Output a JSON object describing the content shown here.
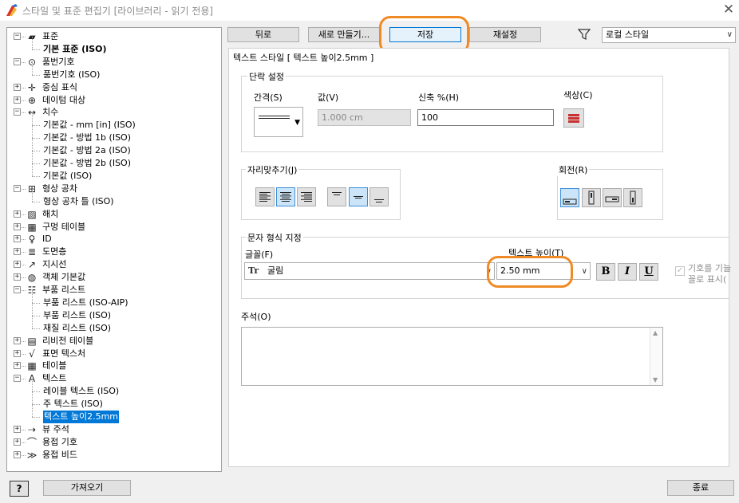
{
  "window": {
    "title": "스타일 및 표준 편집기 [라이브러리 - 읽기 전용]",
    "close_glyph": "✕"
  },
  "tree": [
    {
      "label": "표준",
      "level": 0,
      "toggle": "−",
      "icon": "standard-icon",
      "bold": false
    },
    {
      "label": "기본 표준 (ISO)",
      "level": 1,
      "bold": true
    },
    {
      "label": "품번기호",
      "level": 0,
      "toggle": "−",
      "icon": "balloon-icon"
    },
    {
      "label": "품번기호 (ISO)",
      "level": 1
    },
    {
      "label": "중심 표식",
      "level": 0,
      "toggle": "+",
      "icon": "center-mark-icon"
    },
    {
      "label": "데이텀 대상",
      "level": 0,
      "toggle": "+",
      "icon": "datum-target-icon"
    },
    {
      "label": "치수",
      "level": 0,
      "toggle": "−",
      "icon": "dimension-icon"
    },
    {
      "label": "기본값 - mm [in] (ISO)",
      "level": 1
    },
    {
      "label": "기본값 - 방법 1b (ISO)",
      "level": 1
    },
    {
      "label": "기본값 - 방법 2a (ISO)",
      "level": 1
    },
    {
      "label": "기본값 - 방법 2b (ISO)",
      "level": 1
    },
    {
      "label": "기본값 (ISO)",
      "level": 1
    },
    {
      "label": "형상 공차",
      "level": 0,
      "toggle": "−",
      "icon": "feature-control-icon"
    },
    {
      "label": "형상 공차 틀 (ISO)",
      "level": 1
    },
    {
      "label": "해치",
      "level": 0,
      "toggle": "+",
      "icon": "hatch-icon"
    },
    {
      "label": "구멍 테이블",
      "level": 0,
      "toggle": "+",
      "icon": "hole-table-icon"
    },
    {
      "label": "ID",
      "level": 0,
      "toggle": "+",
      "icon": "id-icon"
    },
    {
      "label": "도면층",
      "level": 0,
      "toggle": "+",
      "icon": "layers-icon"
    },
    {
      "label": "지시선",
      "level": 0,
      "toggle": "+",
      "icon": "leader-icon"
    },
    {
      "label": "객체 기본값",
      "level": 0,
      "toggle": "+",
      "icon": "object-defaults-icon"
    },
    {
      "label": "부품 리스트",
      "level": 0,
      "toggle": "−",
      "icon": "parts-list-icon"
    },
    {
      "label": "부품 리스트 (ISO-AIP)",
      "level": 1
    },
    {
      "label": "부품 리스트 (ISO)",
      "level": 1
    },
    {
      "label": "재질 리스트 (ISO)",
      "level": 1
    },
    {
      "label": "리비전 테이블",
      "level": 0,
      "toggle": "+",
      "icon": "revision-table-icon"
    },
    {
      "label": "표면 텍스처",
      "level": 0,
      "toggle": "+",
      "icon": "surface-texture-icon"
    },
    {
      "label": "테이블",
      "level": 0,
      "toggle": "+",
      "icon": "table-icon"
    },
    {
      "label": "텍스트",
      "level": 0,
      "toggle": "−",
      "icon": "text-icon"
    },
    {
      "label": "레이블 텍스트 (ISO)",
      "level": 1
    },
    {
      "label": "주 텍스트 (ISO)",
      "level": 1
    },
    {
      "label": "텍스트 높이2.5mm",
      "level": 1,
      "selected": true
    },
    {
      "label": "뷰 주석",
      "level": 0,
      "toggle": "+",
      "icon": "view-annotation-icon"
    },
    {
      "label": "용접 기호",
      "level": 0,
      "toggle": "+",
      "icon": "weld-symbol-icon"
    },
    {
      "label": "용접 비드",
      "level": 0,
      "toggle": "+",
      "icon": "weld-bead-icon"
    }
  ],
  "toolbar": {
    "back": "뒤로",
    "new": "새로 만들기...",
    "save": "저장",
    "reset": "재설정",
    "style_filter": "로컬 스타일"
  },
  "main": {
    "title": "텍스트 스타일 [ 텍스트 높이2.5mm ]",
    "paragraph": {
      "group": "단락 설정",
      "spacing_label": "간격(S)",
      "value_label": "값(V)",
      "value": "1.000 cm",
      "stretch_label": "신축 %(H)",
      "stretch_value": "100",
      "color_label": "색상(C)"
    },
    "justification": {
      "group": "자리맞추기(J)"
    },
    "rotation": {
      "group": "회전(R)"
    },
    "format": {
      "group": "문자 형식 지정",
      "font_label": "글꼴(F)",
      "font_value": "굴림",
      "font_icon_text": "Tr",
      "height_label": "텍스트 높이(T)",
      "height_value": "2.50 mm",
      "bold": "B",
      "italic": "I",
      "underline": "U",
      "symbol_label_1": "기호를 기늘",
      "symbol_label_2": "꼴로 표시("
    },
    "notes_label": "주석(O)"
  },
  "footer": {
    "help": "?",
    "import": "가져오기",
    "done": "종료"
  },
  "colors": {
    "accent_ring": "#f08a24",
    "selection": "#0078d7"
  }
}
